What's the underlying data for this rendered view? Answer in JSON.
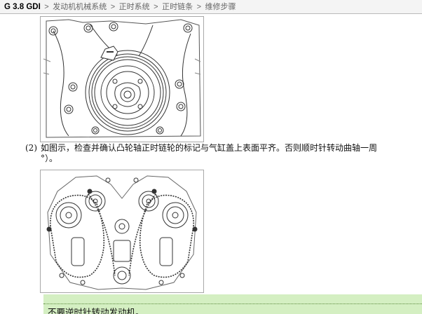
{
  "breadcrumb": {
    "model": "G 3.8 GDI",
    "separator": ">",
    "items": [
      "发动机机械系统",
      "正时系统",
      "正时链条",
      "维修步骤"
    ]
  },
  "step2": {
    "number": "(2)",
    "line1": "如图示，检查并确认凸轮轴正时链轮的标记与气缸盖上表面平齐。否则顺时针转动曲轴一周",
    "line2": "°）。"
  },
  "note": {
    "text": "不要逆时针转动发动机。"
  },
  "colors": {
    "note_background": "#d4efc2",
    "breadcrumb_background": "#f4f4f4"
  }
}
